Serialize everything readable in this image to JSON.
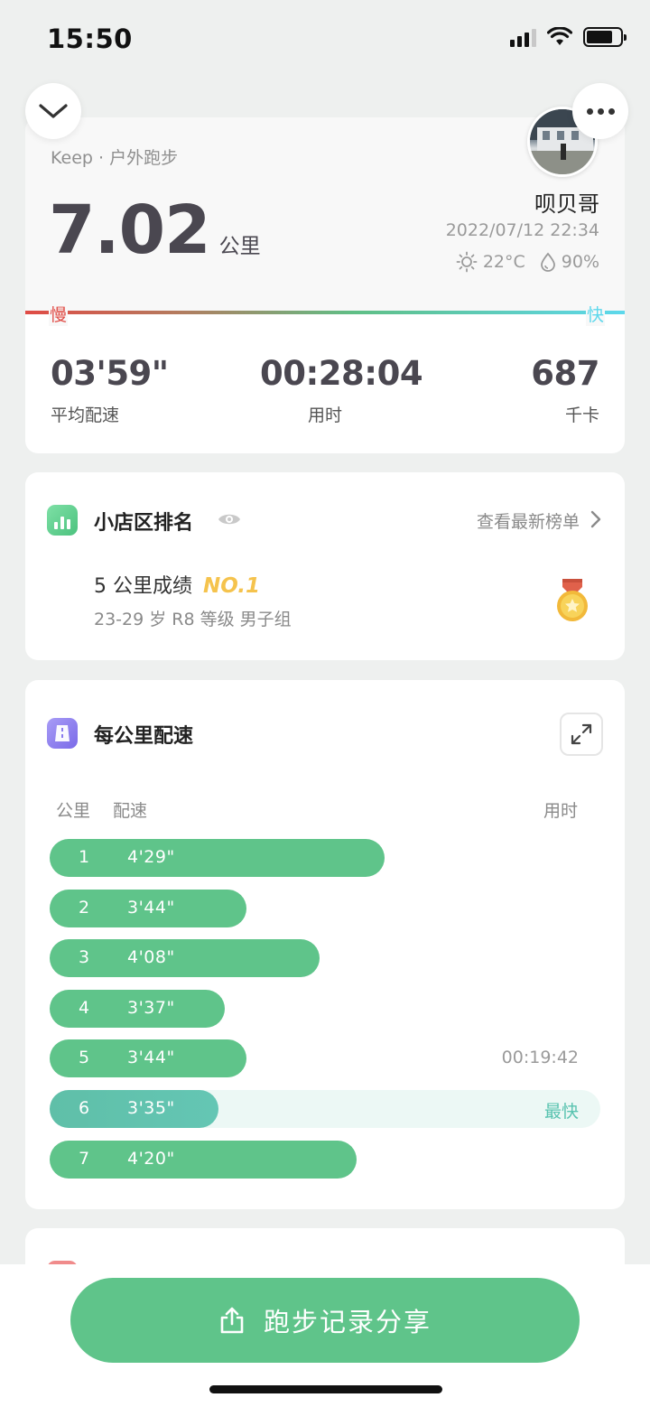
{
  "status_bar": {
    "time": "15:50"
  },
  "summary": {
    "source": "Keep · 户外跑步",
    "distance": "7.02",
    "distance_unit": "公里",
    "username": "呗贝哥",
    "datetime": "2022/07/12 22:34",
    "temperature": "22°C",
    "humidity": "90%",
    "speed_slow": "慢",
    "speed_fast": "快",
    "stats": [
      {
        "value": "03'59\"",
        "label": "平均配速"
      },
      {
        "value": "00:28:04",
        "label": "用时"
      },
      {
        "value": "687",
        "label": "千卡"
      }
    ]
  },
  "ranking": {
    "title": "小店区排名",
    "link": "查看最新榜单",
    "record": "5 公里成绩",
    "rank": "NO.1",
    "group": "23-29 岁 R8 等级 男子组"
  },
  "pace": {
    "title": "每公里配速",
    "headers": {
      "km": "公里",
      "pace": "配速",
      "time": "用时"
    },
    "fastest_label": "最快",
    "rows": [
      {
        "km": "1",
        "pace": "4'29\"",
        "pace_seconds": 269,
        "time": ""
      },
      {
        "km": "2",
        "pace": "3'44\"",
        "pace_seconds": 224,
        "time": ""
      },
      {
        "km": "3",
        "pace": "4'08\"",
        "pace_seconds": 248,
        "time": ""
      },
      {
        "km": "4",
        "pace": "3'37\"",
        "pace_seconds": 217,
        "time": ""
      },
      {
        "km": "5",
        "pace": "3'44\"",
        "pace_seconds": 224,
        "time": "00:19:42"
      },
      {
        "km": "6",
        "pace": "3'35\"",
        "pace_seconds": 215,
        "time": "",
        "fastest": true
      },
      {
        "km": "7",
        "pace": "4'20\"",
        "pace_seconds": 260,
        "time": ""
      }
    ]
  },
  "share": {
    "label": "跑步记录分享"
  },
  "colors": {
    "accent_green": "#5fc48a",
    "rank_gold": "#f5c34d",
    "slow_red": "#e04b45",
    "fast_cyan": "#5dd8ec"
  }
}
